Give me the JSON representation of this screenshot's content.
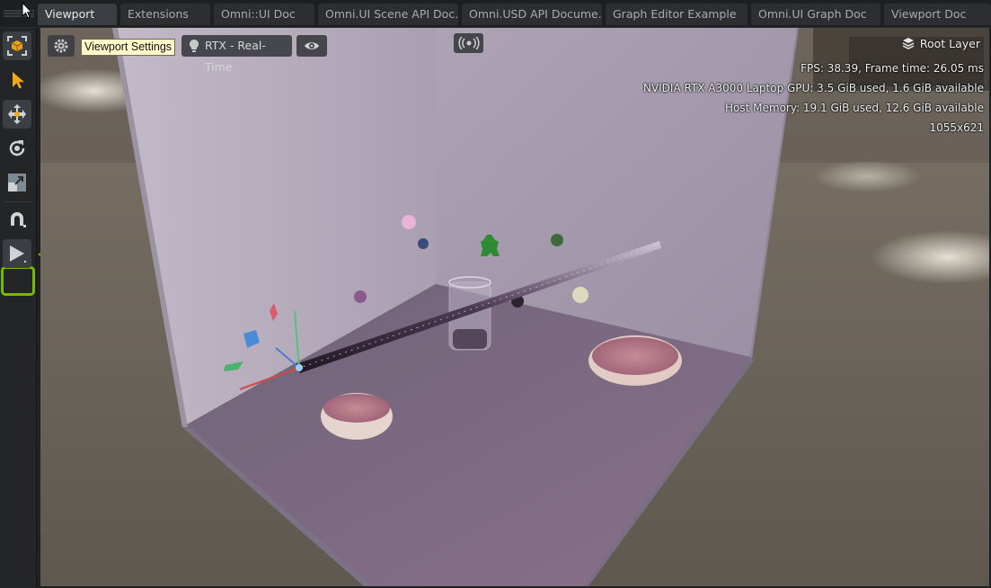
{
  "tabs": [
    {
      "label": "Viewport",
      "active": true
    },
    {
      "label": "Extensions",
      "active": false
    },
    {
      "label": "Omni::UI Doc",
      "active": false
    },
    {
      "label": "Omni.UI Scene API Doc...",
      "active": false
    },
    {
      "label": "Omni.USD API Docume...",
      "active": false
    },
    {
      "label": "Graph Editor Example",
      "active": false
    },
    {
      "label": "Omni.UI Graph Doc",
      "active": false
    },
    {
      "label": "Viewport Doc",
      "active": false
    }
  ],
  "toolbar": {
    "tools": [
      "selection-mode-icon",
      "select-arrow-icon",
      "move-icon",
      "rotate-icon",
      "scale-icon",
      "snap-magnet-icon",
      "play-icon"
    ],
    "highlight_color": "#76b900"
  },
  "viewport": {
    "settings_tooltip": "Viewport Settings",
    "render_mode_label": "RTX - Real-Time",
    "stage_label": "Root Layer",
    "stats": {
      "fps": "FPS: 38.39, Frame time: 26.05 ms",
      "gpu": "NVIDIA RTX A3000 Laptop GPU: 3.5 GiB used,  1.6 GiB available",
      "host_memory": "Host Memory: 19.1 GiB used, 12.6 GiB available",
      "resolution": "1055x621"
    }
  },
  "colors": {
    "accent_green": "#76b900",
    "tab_active": "#3a3d41",
    "tooltip_bg": "#fff9c9"
  }
}
